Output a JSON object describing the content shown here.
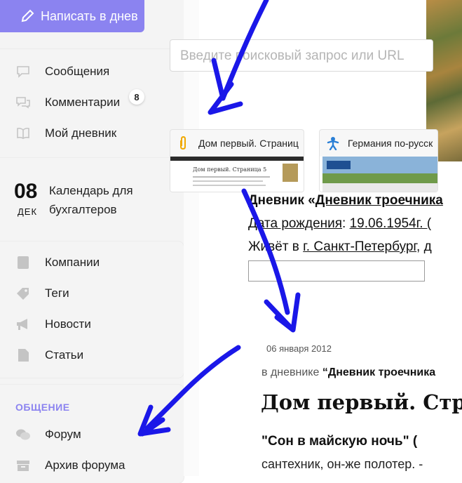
{
  "toolbar": {
    "write_label": "Написать в днев"
  },
  "nav_top": [
    {
      "label": "Сообщения",
      "icon": "chat-icon"
    },
    {
      "label": "Комментарии",
      "icon": "comments-icon",
      "badge": "8"
    },
    {
      "label": "Мой дневник",
      "icon": "book-icon"
    }
  ],
  "calendar": {
    "day": "08",
    "month": "ДЕК",
    "title": "Календарь для бухгалтеров"
  },
  "nav_mid": [
    {
      "label": "Компании",
      "icon": "building-icon"
    },
    {
      "label": "Теги",
      "icon": "tag-icon"
    },
    {
      "label": "Новости",
      "icon": "megaphone-icon"
    },
    {
      "label": "Статьи",
      "icon": "document-icon"
    }
  ],
  "nav_section": {
    "title": "ОБЩЕНИЕ",
    "items": [
      {
        "label": "Форум",
        "icon": "forum-icon"
      },
      {
        "label": "Архив форума",
        "icon": "archive-icon"
      }
    ]
  },
  "search": {
    "placeholder": "Введите поисковый запрос или URL"
  },
  "tiles": [
    {
      "title": "Дом первый. Страниц",
      "icon": "paperclip-icon",
      "thumb_title": "Дом первый. Страница 5"
    },
    {
      "title": "Германия по-русск",
      "icon": "person-icon"
    }
  ],
  "diary": {
    "line1_prefix": "Дневник «",
    "line1_link": "Дневник троечника",
    "line2_label": "Дата рождения",
    "line2_sep": ": ",
    "line2_value": "19.06.1954г. (",
    "line3_prefix": "Живёт в ",
    "line3_link": "г. Санкт-Петербург",
    "line3_suffix": ", д"
  },
  "post": {
    "date": "06 января 2012",
    "in_diary_prefix": "в дневнике ",
    "in_diary_name": "“Дневник троечника",
    "title": "Дом первый. Стра",
    "subtitle": "\"Сон в майскую ночь\" (",
    "text": "сантехник, он-же полотер. -"
  },
  "colors": {
    "accent": "#8b83f0",
    "arrow": "#1a17e8"
  }
}
